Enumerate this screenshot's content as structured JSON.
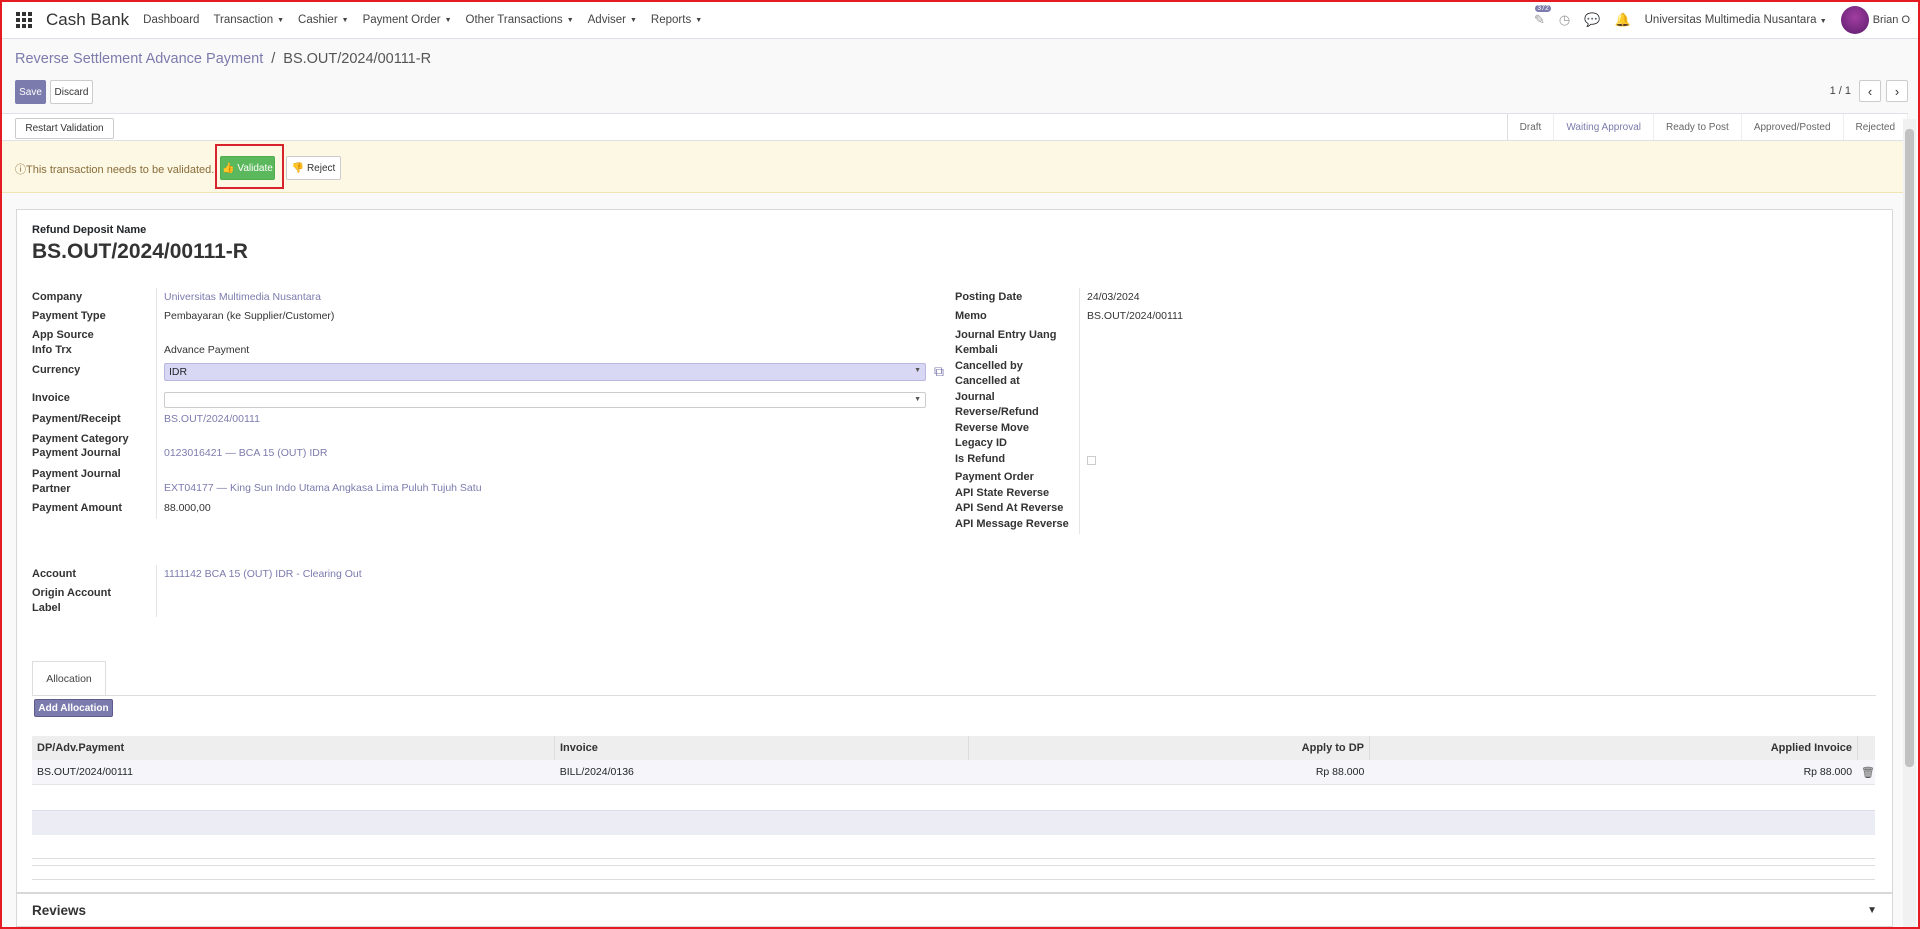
{
  "app": {
    "name": "Cash Bank"
  },
  "menu": [
    {
      "label": "Dashboard",
      "caret": false
    },
    {
      "label": "Transaction",
      "caret": true
    },
    {
      "label": "Cashier",
      "caret": true
    },
    {
      "label": "Payment Order",
      "caret": true
    },
    {
      "label": "Other Transactions",
      "caret": true
    },
    {
      "label": "Adviser",
      "caret": true
    },
    {
      "label": "Reports",
      "caret": true
    }
  ],
  "systray": {
    "activity_badge": "372",
    "company": "Universitas Multimedia Nusantara",
    "user": "Brian O"
  },
  "breadcrumb": {
    "parent": "Reverse Settlement Advance Payment",
    "separator": "/",
    "current": "BS.OUT/2024/00111-R"
  },
  "buttons": {
    "save": "Save",
    "discard": "Discard",
    "restart": "Restart Validation",
    "validate": "Validate",
    "reject": "Reject",
    "add_allocation": "Add Allocation"
  },
  "pager": {
    "value": "1 / 1"
  },
  "stages": [
    "Draft",
    "Waiting Approval",
    "Ready to Post",
    "Approved/Posted",
    "Rejected"
  ],
  "active_stage": "Waiting Approval",
  "alert": {
    "text": "This transaction needs to be validated."
  },
  "form": {
    "title_label": "Refund Deposit Name",
    "title": "BS.OUT/2024/00111-R",
    "left": {
      "company_label": "Company",
      "company": "Universitas Multimedia Nusantara",
      "payment_type_label": "Payment Type",
      "payment_type": "Pembayaran (ke Supplier/Customer)",
      "app_source_label": "App Source",
      "info_trx_label": "Info Trx",
      "info_trx": "Advance Payment",
      "currency_label": "Currency",
      "currency": "IDR",
      "invoice_label": "Invoice",
      "invoice": "",
      "payment_receipt_label": "Payment/Receipt",
      "payment_receipt": "BS.OUT/2024/00111",
      "payment_category_label": "Payment Category",
      "payment_journal_label": "Payment Journal",
      "payment_journal": "0123016421 — BCA 15 (OUT) IDR",
      "payment_journal_partner_label": "Payment Journal Partner",
      "payment_journal_partner": "EXT04177 — King Sun Indo Utama Angkasa Lima Puluh Tujuh Satu",
      "payment_amount_label": "Payment Amount",
      "payment_amount": "88.000,00"
    },
    "right": {
      "posting_date_label": "Posting Date",
      "posting_date": "24/03/2024",
      "memo_label": "Memo",
      "memo": "BS.OUT/2024/00111",
      "journal_entry_label": "Journal Entry Uang Kembali",
      "cancelled_by_label": "Cancelled by",
      "cancelled_at_label": "Cancelled at",
      "journal_reverse_label": "Journal Reverse/Refund",
      "reverse_move_label": "Reverse Move",
      "legacy_id_label": "Legacy ID",
      "is_refund_label": "Is Refund",
      "payment_order_label": "Payment Order",
      "api_state_label": "API State Reverse",
      "api_send_label": "API Send At Reverse",
      "api_message_label": "API Message Reverse"
    },
    "account_label": "Account",
    "account": "1111142 BCA 15 (OUT) IDR - Clearing Out",
    "origin_account_label": "Origin Account Label"
  },
  "tabs": [
    "Allocation"
  ],
  "table": {
    "headers": [
      "DP/Adv.Payment",
      "Invoice",
      "Apply to DP",
      "Applied Invoice"
    ],
    "rows": [
      {
        "dp": "BS.OUT/2024/00111",
        "invoice": "BILL/2024/0136",
        "apply_dp": "Rp 88.000",
        "applied_invoice": "Rp 88.000"
      }
    ]
  },
  "reviews": {
    "title": "Reviews"
  },
  "colors": {
    "primary": "#7c7bad",
    "validate": "#5cb85c",
    "alert_bg": "#fcf8e3",
    "highlight": "#d9232c"
  }
}
